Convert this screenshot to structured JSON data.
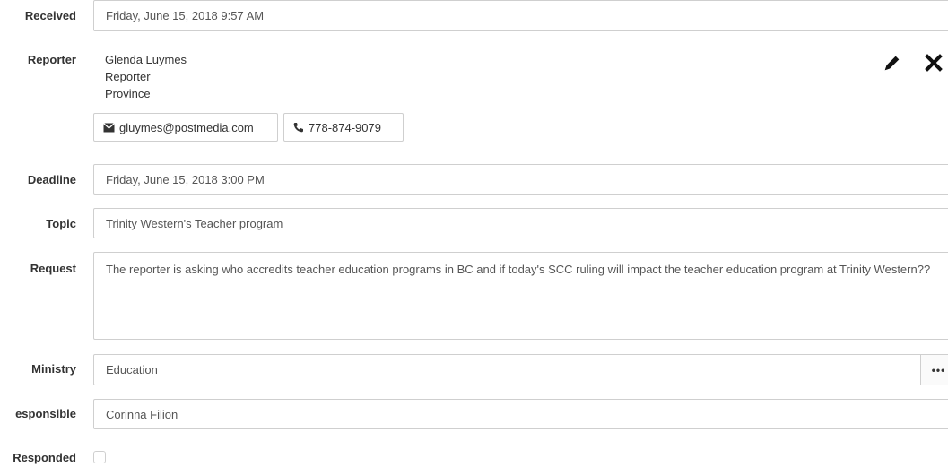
{
  "received": {
    "label": "Received",
    "value": "Friday, June 15, 2018 9:57 AM"
  },
  "reporter": {
    "label": "Reporter",
    "name": "Glenda Luymes",
    "role": "Reporter",
    "outlet": "Province",
    "email": "gluymes@postmedia.com",
    "phone": "778-874-9079",
    "icons": {
      "edit": "pencil-icon",
      "remove": "close-icon",
      "email": "envelope-icon",
      "phone": "phone-icon"
    }
  },
  "deadline": {
    "label": "Deadline",
    "value": "Friday, June 15, 2018 3:00 PM"
  },
  "topic": {
    "label": "Topic",
    "value": "Trinity Western's Teacher program"
  },
  "request": {
    "label": "Request",
    "value": "The reporter is asking who accredits teacher education programs in BC and if today's SCC ruling will impact the teacher education program at Trinity Western??"
  },
  "ministry": {
    "label": "Ministry",
    "value": "Education",
    "more_label": "•••"
  },
  "responsible": {
    "label": "esponsible",
    "value": "Corinna Filion"
  },
  "responded": {
    "label": "Responded",
    "checked": false
  }
}
